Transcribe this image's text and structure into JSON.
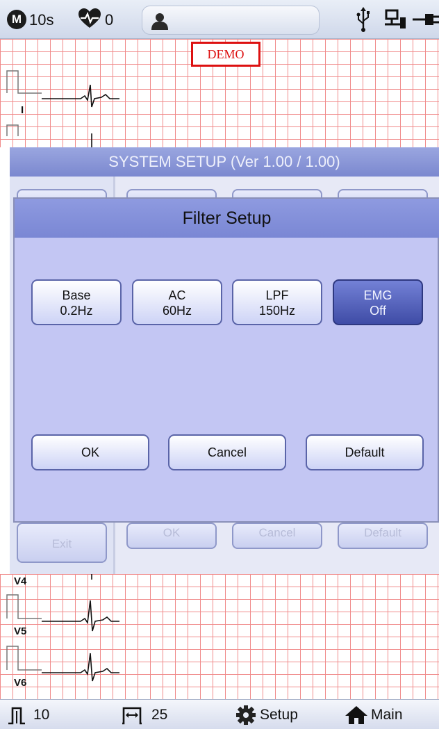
{
  "status_bar": {
    "mode_badge": "M",
    "duration": "10s",
    "heart_rate": "0",
    "icons": [
      "person-icon",
      "usb-icon",
      "network-icon",
      "power-plug-icon"
    ]
  },
  "ecg_top": {
    "demo_label": "DEMO",
    "leads": [
      "I"
    ]
  },
  "system_setup": {
    "title": "SYSTEM SETUP (Ver 1.00 / 1.00)",
    "exit_label": "Exit",
    "ok_label": "OK",
    "cancel_label": "Cancel",
    "default_label": "Default"
  },
  "filter_dialog": {
    "title": "Filter Setup",
    "options": [
      {
        "name": "Base",
        "value": "0.2Hz",
        "active": false
      },
      {
        "name": "AC",
        "value": "60Hz",
        "active": false
      },
      {
        "name": "LPF",
        "value": "150Hz",
        "active": false
      },
      {
        "name": "EMG",
        "value": "Off",
        "active": true
      }
    ],
    "ok_label": "OK",
    "cancel_label": "Cancel",
    "default_label": "Default"
  },
  "ecg_bottom": {
    "leads": [
      "V4",
      "V5",
      "V6"
    ]
  },
  "bottom_bar": {
    "sensitivity": "10",
    "speed": "25",
    "setup_label": "Setup",
    "main_label": "Main"
  },
  "colors": {
    "grid": "#f08a8a",
    "dialog_bg": "#c3c6f3",
    "dialog_title": "#7a87d4",
    "active_button": "#3f4ca6",
    "demo_red": "#dd1111"
  }
}
